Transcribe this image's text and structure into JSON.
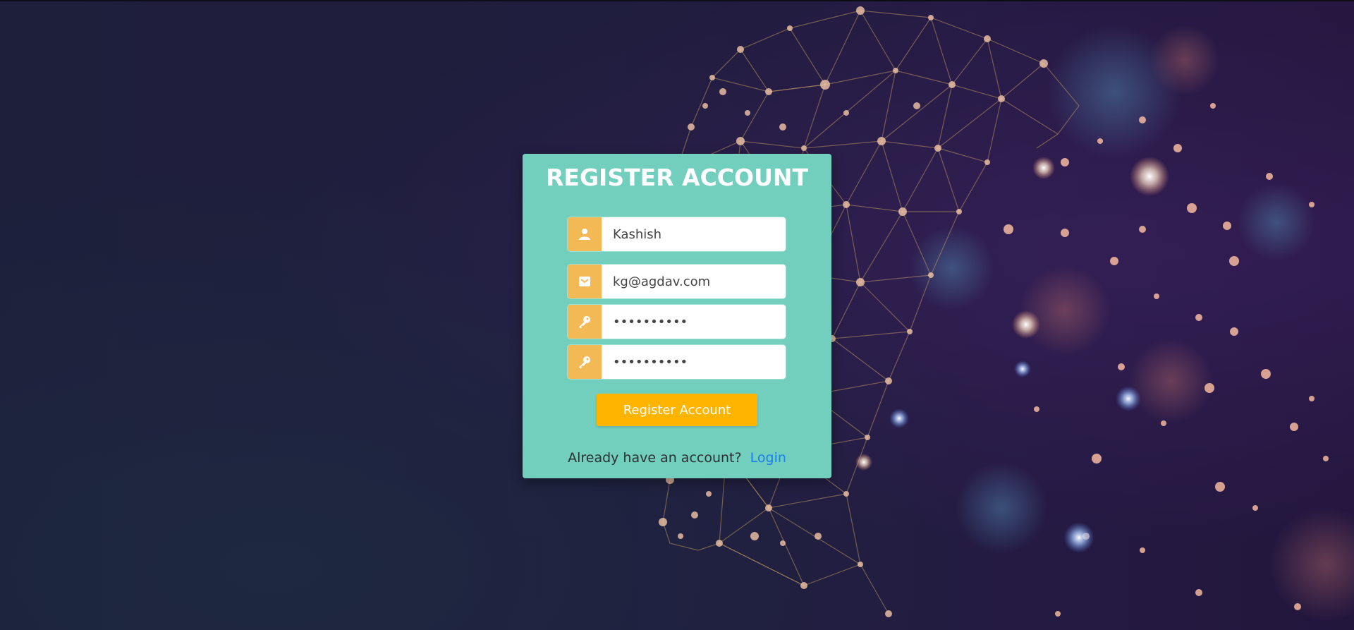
{
  "form": {
    "title": "REGISTER ACCOUNT",
    "fields": [
      {
        "icon": "user-icon",
        "type": "text",
        "value": "Kashish"
      },
      {
        "icon": "envelope-icon",
        "type": "email",
        "value": "kg@agdav.com"
      },
      {
        "icon": "key-icon",
        "type": "password",
        "value": "••••••••••"
      },
      {
        "icon": "key-icon",
        "type": "password",
        "value": "••••••••••"
      }
    ],
    "submit_label": "Register Account",
    "footer_text": "Already have an account?",
    "login_link": "Login"
  },
  "colors": {
    "card_bg": "#72cfbd",
    "addon_bg": "#f2b955",
    "button_bg": "#ffb400",
    "link": "#1a7ef2",
    "page_bg": "#1f1e3a"
  }
}
